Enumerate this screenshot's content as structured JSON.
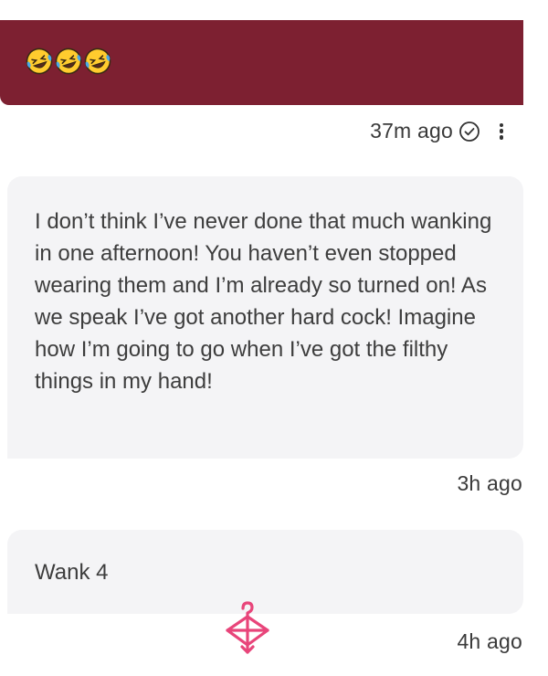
{
  "sent_message": {
    "emojis": [
      "rofl-emoji",
      "rofl-emoji",
      "rofl-emoji"
    ],
    "timestamp": "37m ago",
    "status_icon": "check-circle-icon",
    "menu_icon": "more-vertical-icon",
    "bubble_color": "#7d2031"
  },
  "received_messages": [
    {
      "text": "I don’t think I’ve never done that much wanking in one afternoon! You haven’t even stopped wearing them and I’m already so turned on! As we speak I’ve got another hard cock! Imagine how I’m going to go when I’ve got the filthy things in my hand!",
      "timestamp": "3h ago"
    },
    {
      "text": "Wank 4",
      "timestamp": "4h ago"
    }
  ],
  "watermark": {
    "icon": "hanger-bow-logo-icon",
    "color": "#e8457a"
  }
}
